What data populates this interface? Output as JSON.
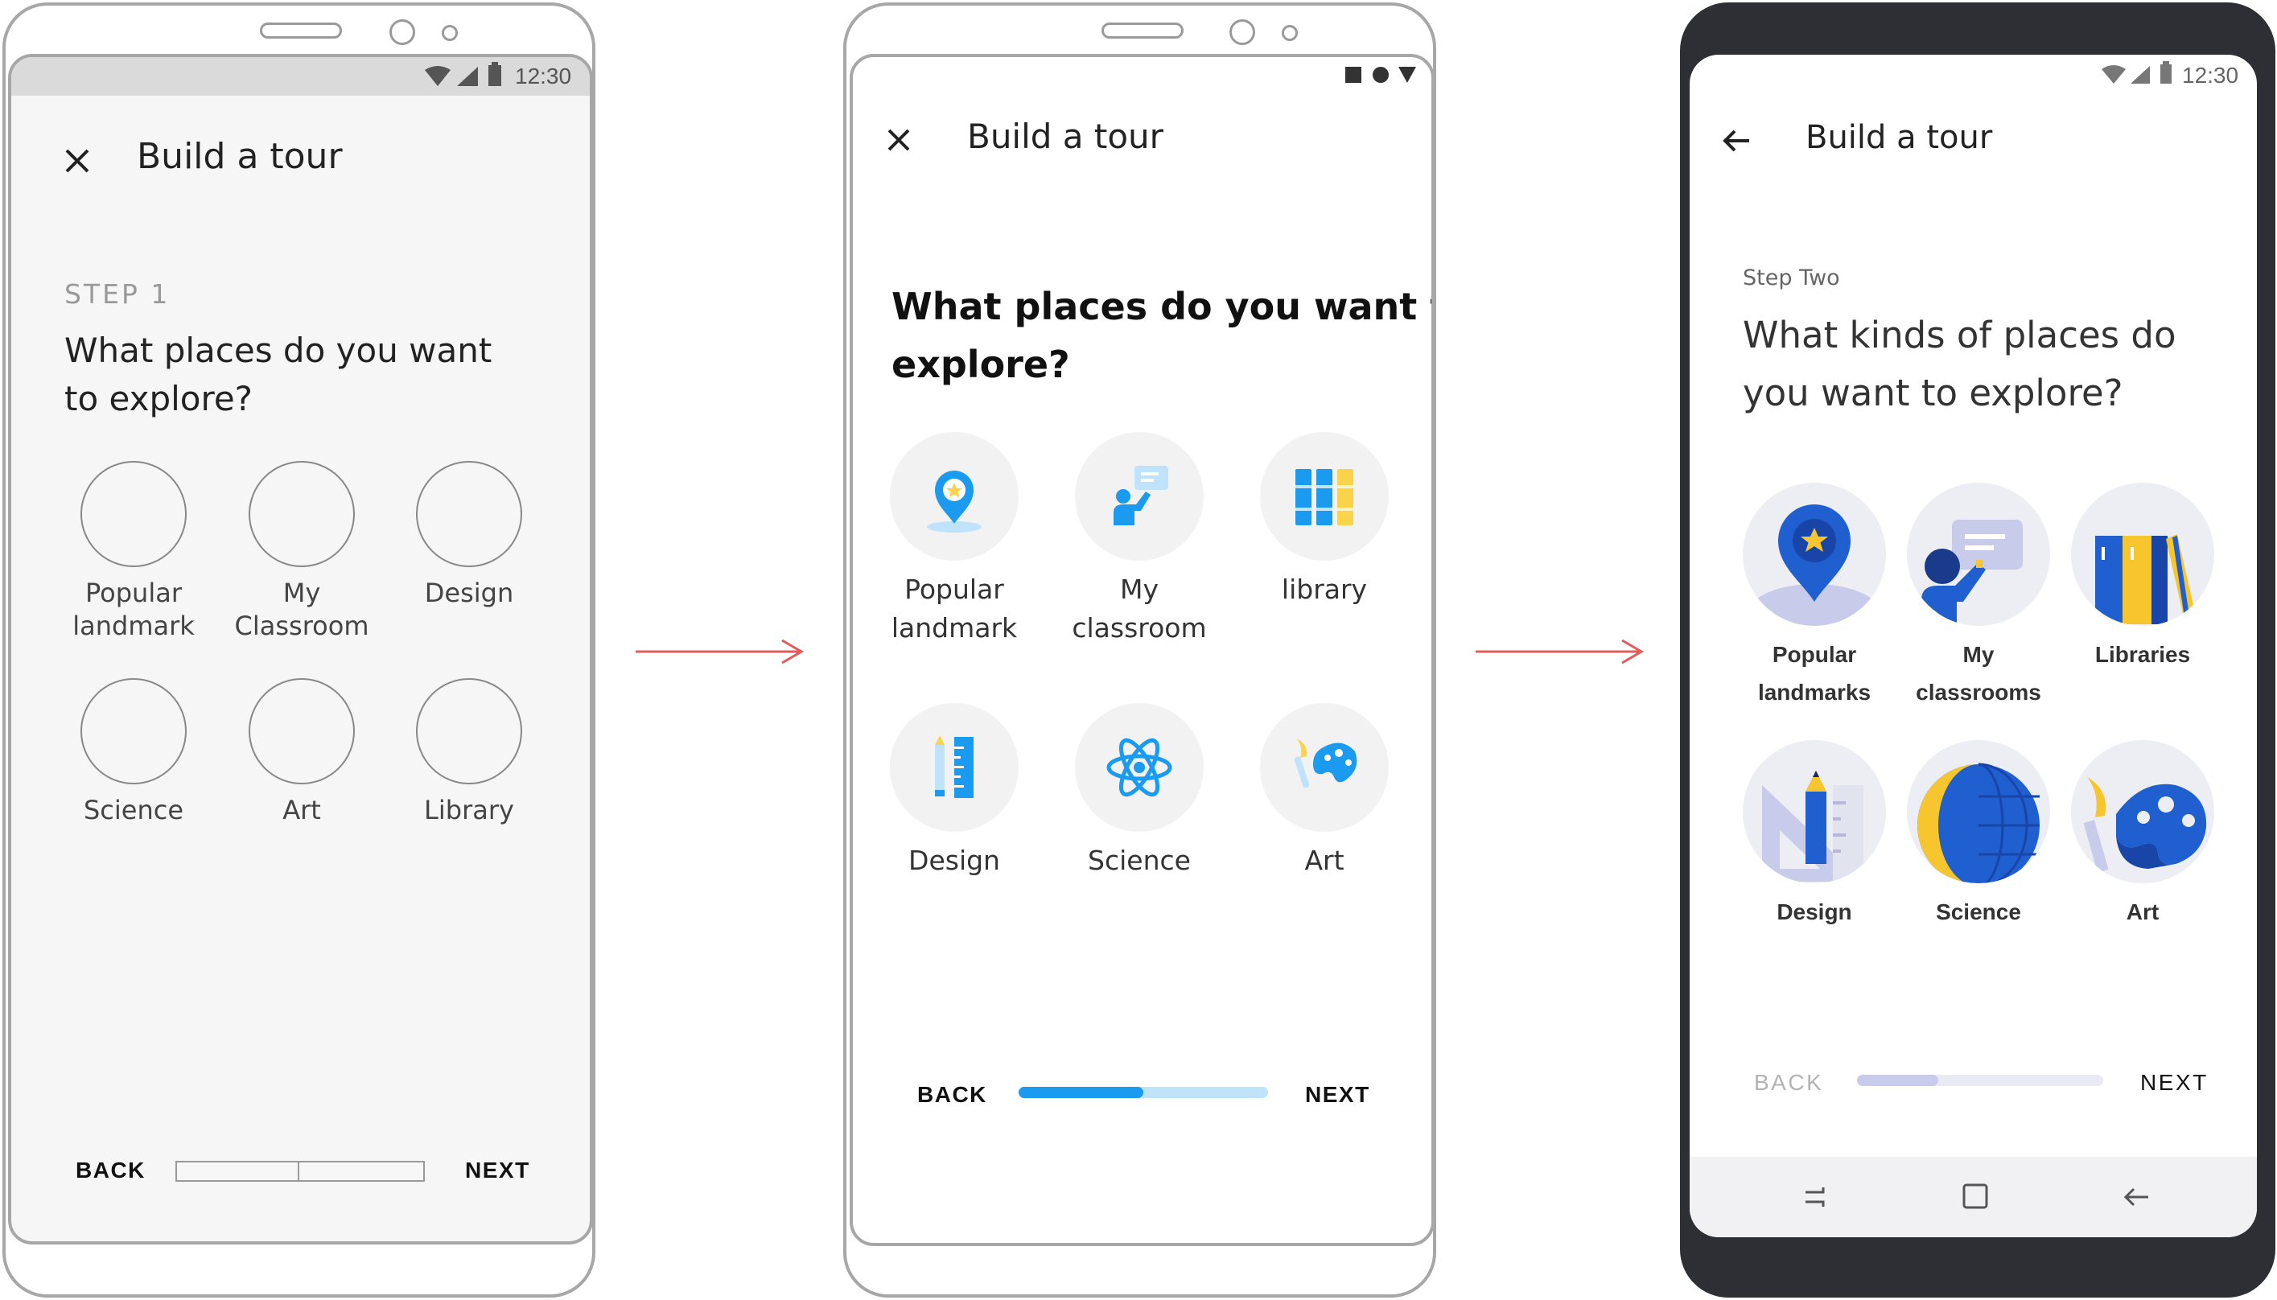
{
  "status": {
    "time": "12:30"
  },
  "arrows": {
    "color": "#e45b5b"
  },
  "wireframe": {
    "title": "Build a tour",
    "step": "STEP 1",
    "question_line1": "What places do you want",
    "question_line2": "to explore?",
    "items": [
      {
        "line1": "Popular",
        "line2": "landmark"
      },
      {
        "line1": "My",
        "line2": "Classroom"
      },
      {
        "line1": "Design",
        "line2": ""
      },
      {
        "line1": "Science",
        "line2": ""
      },
      {
        "line1": "Art",
        "line2": ""
      },
      {
        "line1": "Library",
        "line2": ""
      }
    ],
    "back": "BACK",
    "next": "NEXT",
    "progress": {
      "steps": 2,
      "current": 1
    }
  },
  "midfi": {
    "title": "Build a tour",
    "question_line1": "What places do you want to",
    "question_line2": "explore?",
    "items": [
      {
        "line1": "Popular",
        "line2": "landmark",
        "icon": "landmark-pin-icon"
      },
      {
        "line1": "My",
        "line2": "classroom",
        "icon": "classroom-teacher-icon"
      },
      {
        "line1": "library",
        "line2": "",
        "icon": "library-books-icon"
      },
      {
        "line1": "Design",
        "line2": "",
        "icon": "design-ruler-pencil-icon"
      },
      {
        "line1": "Science",
        "line2": "",
        "icon": "science-atom-icon"
      },
      {
        "line1": "Art",
        "line2": "",
        "icon": "art-palette-icon"
      }
    ],
    "back": "BACK",
    "next": "NEXT",
    "progress": {
      "fraction": 0.5
    },
    "colors": {
      "primary": "#1a9bf0",
      "accent": "#fbd34a",
      "track": "#bfe3fb"
    }
  },
  "hifi": {
    "title": "Build a tour",
    "step": "Step Two",
    "question_line1": "What kinds of places do",
    "question_line2": "you want to explore?",
    "items": [
      {
        "line1": "Popular",
        "line2": "landmarks",
        "icon": "landmark-pin-icon"
      },
      {
        "line1": "My",
        "line2": "classrooms",
        "icon": "classroom-teacher-icon"
      },
      {
        "line1": "Libraries",
        "line2": "",
        "icon": "library-books-icon"
      },
      {
        "line1": "Design",
        "line2": "",
        "icon": "design-ruler-pencil-icon"
      },
      {
        "line1": "Science",
        "line2": "",
        "icon": "science-globe-icon"
      },
      {
        "line1": "Art",
        "line2": "",
        "icon": "art-palette-icon"
      }
    ],
    "back": "BACK",
    "next": "NEXT",
    "progress": {
      "fraction": 0.33
    },
    "colors": {
      "primary": "#1f5fcf",
      "accent": "#f7c62f",
      "track": "#e9eaf3",
      "fill": "#c9cbeb"
    }
  }
}
